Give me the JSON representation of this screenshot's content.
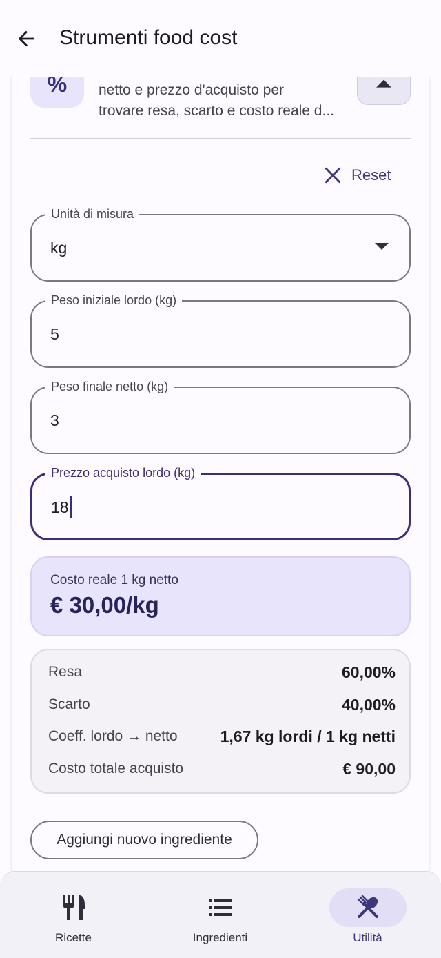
{
  "appbar": {
    "title": "Strumenti food cost"
  },
  "tool": {
    "icon": "percent-icon",
    "icon_glyph": "%",
    "description_line1": "netto e prezzo d'acquisto per",
    "description_line2": "trovare resa, scarto e costo reale d..."
  },
  "reset": {
    "label": "Reset"
  },
  "fields": {
    "unit": {
      "label": "Unità di misura",
      "value": "kg"
    },
    "gross_weight": {
      "label": "Peso iniziale lordo (kg)",
      "value": "5"
    },
    "net_weight": {
      "label": "Peso finale netto (kg)",
      "value": "3"
    },
    "gross_price": {
      "label": "Prezzo acquisto lordo (kg)",
      "value": "18"
    }
  },
  "result": {
    "label": "Costo reale 1 kg netto",
    "value": "€ 30,00/kg"
  },
  "stats": [
    {
      "label": "Resa",
      "value": "60,00%"
    },
    {
      "label": "Scarto",
      "value": "40,00%"
    },
    {
      "label": "Coeff. lordo → netto",
      "value": "1,67 kg lordi / 1 kg netti"
    },
    {
      "label": "Costo totale acquisto",
      "value": "€ 90,00"
    }
  ],
  "add_button": {
    "label": "Aggiungi nuovo ingrediente"
  },
  "bottomnav": {
    "items": [
      {
        "label": "Ricette",
        "icon": "fork-knife-icon"
      },
      {
        "label": "Ingredienti",
        "icon": "list-icon"
      },
      {
        "label": "Utilità",
        "icon": "utensils-crossed-icon",
        "active": true
      }
    ]
  },
  "colors": {
    "accent": "#3b2d77",
    "result_bg": "#e7e4fc",
    "active_nav_bg": "#e1def6"
  }
}
